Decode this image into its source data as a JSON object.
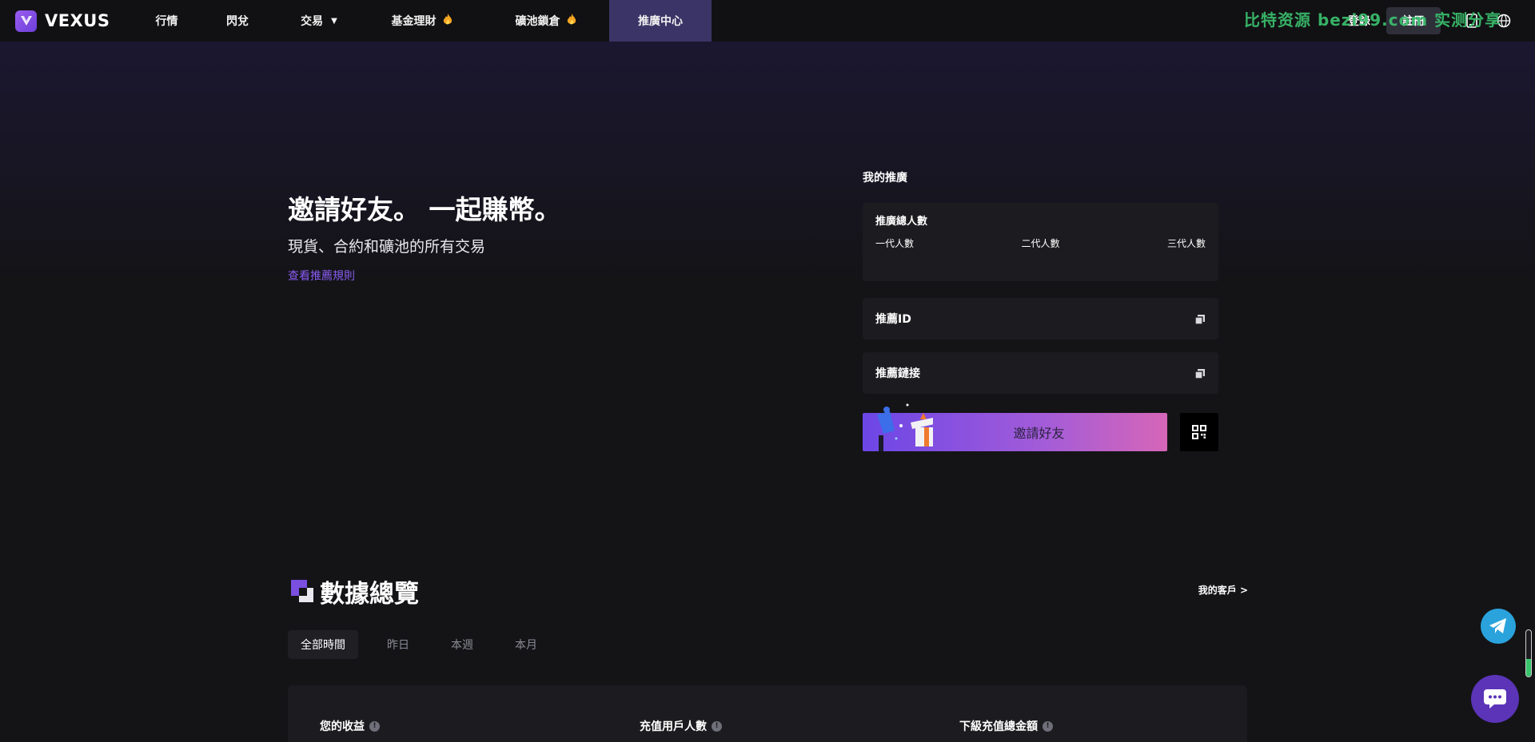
{
  "nav": {
    "logo_text": "VEXUS",
    "items": [
      {
        "label": "行情",
        "fire": false,
        "caret": false,
        "active": false
      },
      {
        "label": "閃兌",
        "fire": false,
        "caret": false,
        "active": false
      },
      {
        "label": "交易",
        "fire": false,
        "caret": true,
        "active": false
      },
      {
        "label": "基金理財",
        "fire": true,
        "caret": false,
        "active": false
      },
      {
        "label": "礦池鎖倉",
        "fire": true,
        "caret": false,
        "active": false
      },
      {
        "label": "推廣中心",
        "fire": false,
        "caret": false,
        "active": true
      }
    ],
    "login_label": "登錄",
    "register_label": "註冊",
    "watermark": "比特资源 bezi99.com 实测分享"
  },
  "hero": {
    "title": "邀請好友。 一起賺幣。",
    "subtitle": "現貨、合約和礦池的所有交易",
    "rules_link": "查看推薦規則"
  },
  "referral": {
    "section_title": "我的推廣",
    "total_label": "推廣總人數",
    "levels": [
      "一代人數",
      "二代人數",
      "三代人數"
    ],
    "id_label": "推薦ID",
    "link_label": "推薦鏈接",
    "invite_button": "邀請好友"
  },
  "overview": {
    "title": "數據總覽",
    "my_clients": "我的客戶 >",
    "tabs": [
      {
        "label": "全部時間",
        "active": true
      },
      {
        "label": "昨日",
        "active": false
      },
      {
        "label": "本週",
        "active": false
      },
      {
        "label": "本月",
        "active": false
      }
    ],
    "stats": [
      {
        "label": "您的收益"
      },
      {
        "label": "充值用戶人數"
      },
      {
        "label": "下級充值總金額"
      }
    ]
  },
  "colors": {
    "accent": "#8a5cf2",
    "nav_active": "#3b3466",
    "telegram": "#2aa3dd",
    "chat": "#5b34b8"
  },
  "icons": {
    "copy": "copy-icon",
    "qr": "qr-code-icon",
    "telegram": "telegram-icon",
    "chat": "chat-icon",
    "download": "download-icon",
    "globe": "globe-icon"
  }
}
